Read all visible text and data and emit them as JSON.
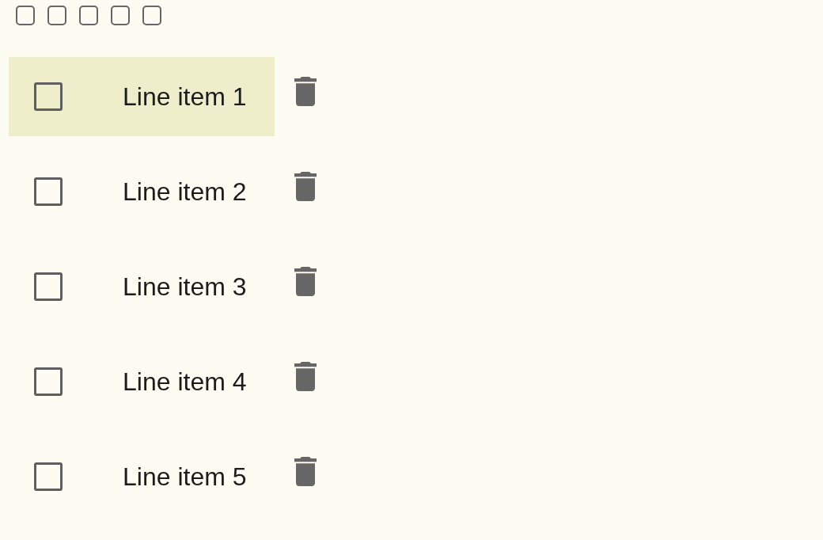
{
  "toolbar": {
    "checkboxes": [
      {
        "checked": false
      },
      {
        "checked": false
      },
      {
        "checked": false
      },
      {
        "checked": false
      },
      {
        "checked": false
      }
    ]
  },
  "items": [
    {
      "label": "Line item 1",
      "checked": false,
      "hovered": true
    },
    {
      "label": "Line item 2",
      "checked": false,
      "hovered": false
    },
    {
      "label": "Line item 3",
      "checked": false,
      "hovered": false
    },
    {
      "label": "Line item 4",
      "checked": false,
      "hovered": false
    },
    {
      "label": "Line item 5",
      "checked": false,
      "hovered": false
    }
  ]
}
